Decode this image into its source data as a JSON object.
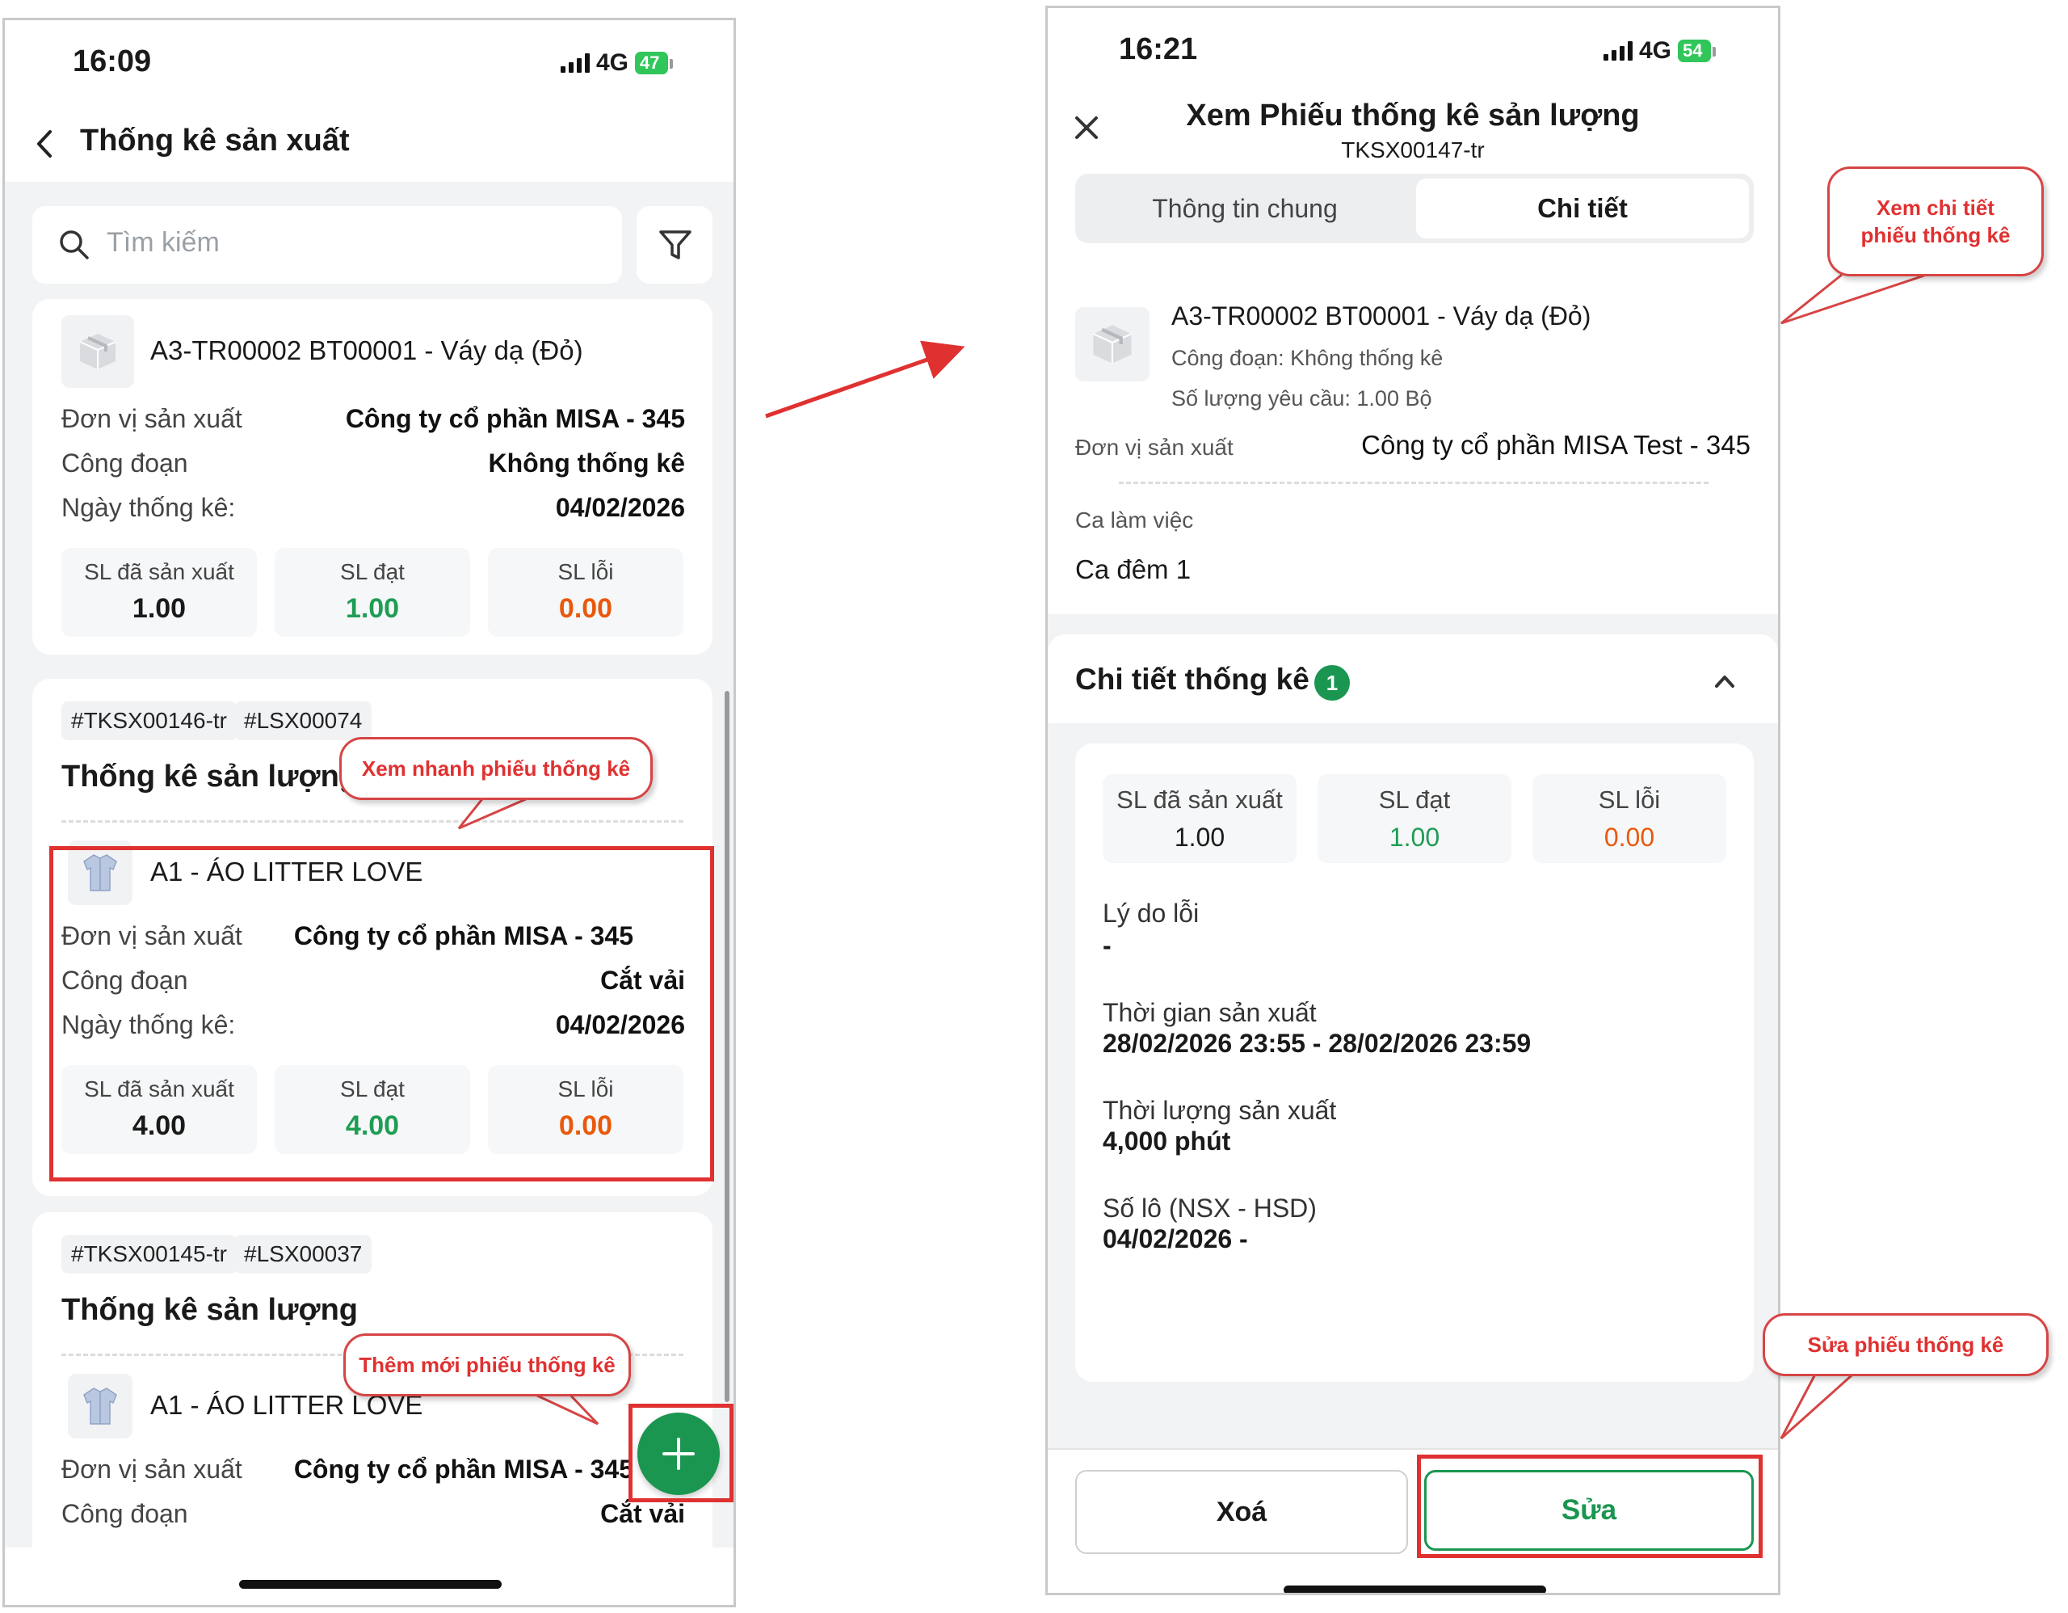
{
  "left_screen": {
    "status": {
      "time": "16:09",
      "network": "4G",
      "battery": "47"
    },
    "header": {
      "title": "Thống kê sản xuất"
    },
    "search": {
      "placeholder": "Tìm kiếm"
    },
    "cards": [
      {
        "product": "A3-TR00002 BT00001 - Váy dạ (Đỏ)",
        "rows": [
          {
            "label": "Đơn vị sản xuất",
            "value": "Công ty cổ phần MISA - 345"
          },
          {
            "label": "Công đoạn",
            "value": "Không thống kê"
          },
          {
            "label": "Ngày thống kê:",
            "value": "04/02/2026"
          }
        ],
        "stats": [
          {
            "label": "SL đã sản xuất",
            "value": "1.00"
          },
          {
            "label": "SL đạt",
            "value": "1.00"
          },
          {
            "label": "SL lỗi",
            "value": "0.00"
          }
        ]
      },
      {
        "tags": [
          "#TKSX00146-tr",
          "#LSX00074"
        ],
        "title": "Thống kê sản lượng",
        "product": "A1 - ÁO LITTER LOVE",
        "rows": [
          {
            "label": "Đơn vị sản xuất",
            "value": "Công ty cổ phần MISA - 345"
          },
          {
            "label": "Công đoạn",
            "value": "Cắt vải"
          },
          {
            "label": "Ngày thống kê:",
            "value": "04/02/2026"
          }
        ],
        "stats": [
          {
            "label": "SL đã sản xuất",
            "value": "4.00"
          },
          {
            "label": "SL đạt",
            "value": "4.00"
          },
          {
            "label": "SL lỗi",
            "value": "0.00"
          }
        ]
      },
      {
        "tags": [
          "#TKSX00145-tr",
          "#LSX00037"
        ],
        "title": "Thống kê sản lượng",
        "product": "A1 - ÁO LITTER LOVE",
        "rows": [
          {
            "label": "Đơn vị sản xuất",
            "value": "Công ty cổ phần MISA - 345"
          },
          {
            "label": "Công đoạn",
            "value": "Cắt vải"
          }
        ]
      }
    ],
    "fab": {
      "icon": "plus-icon"
    }
  },
  "right_screen": {
    "status": {
      "time": "16:21",
      "network": "4G",
      "battery": "54"
    },
    "header": {
      "title": "Xem Phiếu thống kê sản lượng",
      "subtitle": "TKSX00147-tr"
    },
    "tabs": [
      {
        "label": "Thông tin chung",
        "active": false
      },
      {
        "label": "Chi tiết",
        "active": true
      }
    ],
    "product": {
      "name": "A3-TR00002 BT00001 - Váy dạ (Đỏ)",
      "stage": "Công đoạn: Không thống kê",
      "qty": "Số lượng yêu cầu: 1.00 Bộ"
    },
    "unit": {
      "label": "Đơn vị sản xuất",
      "value": "Công ty cổ phần MISA Test - 345"
    },
    "shift": {
      "label": "Ca làm việc",
      "value": "Ca đêm 1"
    },
    "detail_section": {
      "title": "Chi tiết thống kê",
      "count": "1"
    },
    "stats": [
      {
        "label": "SL đã sản xuất",
        "value": "1.00"
      },
      {
        "label": "SL đạt",
        "value": "1.00"
      },
      {
        "label": "SL lỗi",
        "value": "0.00"
      }
    ],
    "fields": [
      {
        "label": "Lý do lỗi",
        "value": "-"
      },
      {
        "label": "Thời gian sản xuất",
        "value": "28/02/2026 23:55 - 28/02/2026 23:59"
      },
      {
        "label": "Thời lượng sản xuất",
        "value": "4,000 phút"
      },
      {
        "label": "Số lô (NSX - HSD)",
        "value": "04/02/2026 -"
      }
    ],
    "buttons": {
      "delete": "Xoá",
      "edit": "Sửa"
    }
  },
  "callouts": {
    "quick_view": "Xem nhanh phiếu thống kê",
    "add_new": "Thêm mới phiếu thống kê",
    "view_detail": "Xem chi tiết phiếu thống kê",
    "edit": "Sửa phiếu thống kê"
  },
  "colors": {
    "accent_green": "#1f9d55",
    "error_orange": "#e8590c",
    "annotation_red": "#e03131"
  }
}
